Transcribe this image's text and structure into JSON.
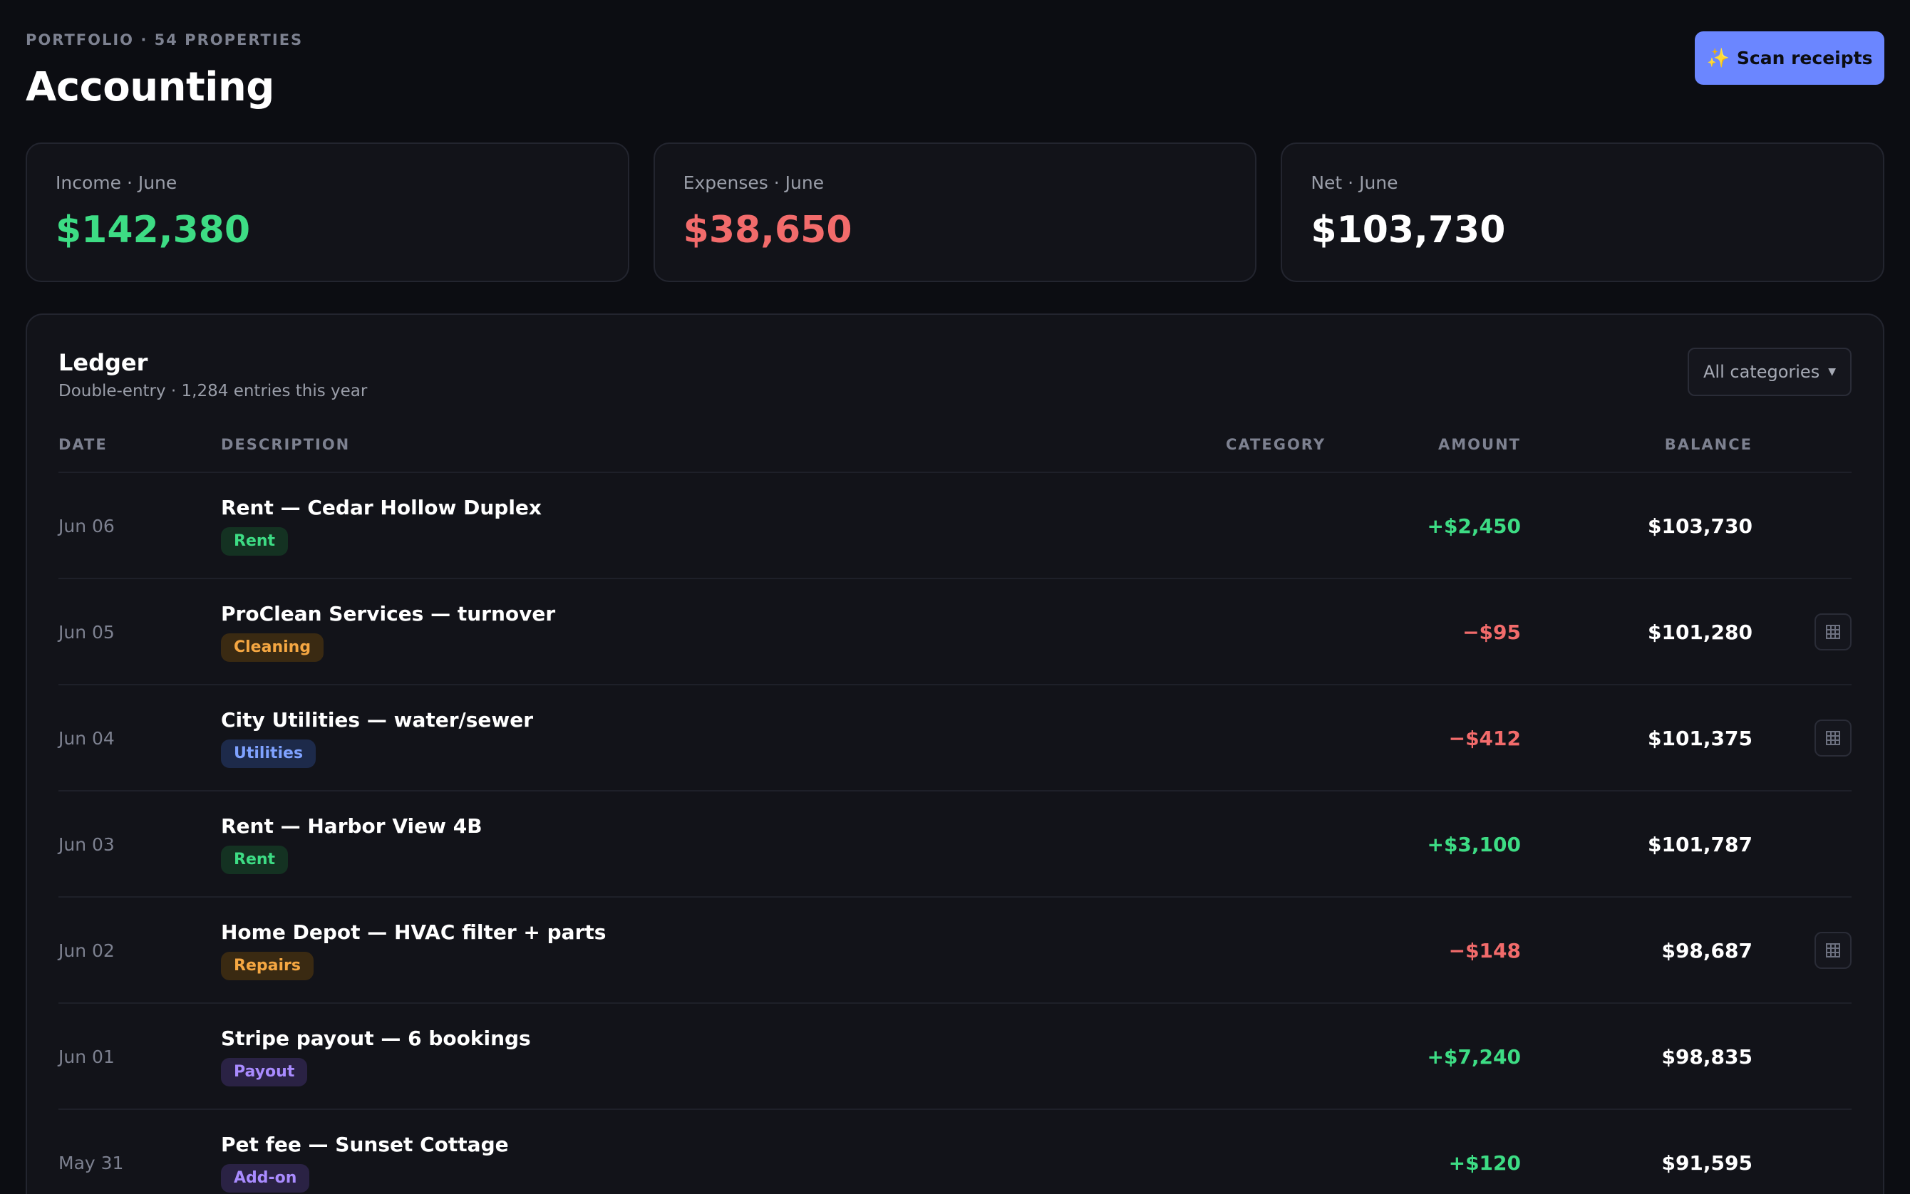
{
  "header": {
    "eyebrow": "PORTFOLIO · 54 PROPERTIES",
    "title": "Accounting",
    "scan_button": "Scan receipts"
  },
  "stats": [
    {
      "label": "Income · June",
      "value": "$142,380",
      "color": "#3ddc84"
    },
    {
      "label": "Expenses · June",
      "value": "$38,650",
      "color": "#f26b6b"
    },
    {
      "label": "Net · June",
      "value": "$103,730",
      "color": "#ffffff"
    }
  ],
  "ledger": {
    "title": "Ledger",
    "subtitle": "Double-entry · 1,284 entries this year",
    "filter": "All categories",
    "columns": {
      "date": "DATE",
      "description": "DESCRIPTION",
      "category": "CATEGORY",
      "amount": "AMOUNT",
      "balance": "BALANCE"
    },
    "rows": [
      {
        "date": "Jun 06",
        "description": "Rent — Cedar Hollow Duplex",
        "tag": "Rent",
        "amount": "+$2,450",
        "balance": "$103,730"
      },
      {
        "date": "Jun 05",
        "description": "ProClean Services — turnover",
        "tag": "Cleaning",
        "amount": "−$95",
        "balance": "$101,280"
      },
      {
        "date": "Jun 04",
        "description": "City Utilities — water/sewer",
        "tag": "Utilities",
        "amount": "−$412",
        "balance": "$101,375"
      },
      {
        "date": "Jun 03",
        "description": "Rent — Harbor View 4B",
        "tag": "Rent",
        "amount": "+$3,100",
        "balance": "$101,787"
      },
      {
        "date": "Jun 02",
        "description": "Home Depot — HVAC filter + parts",
        "tag": "Repairs",
        "amount": "−$148",
        "balance": "$98,687"
      },
      {
        "date": "Jun 01",
        "description": "Stripe payout — 6 bookings",
        "tag": "Payout",
        "amount": "+$7,240",
        "balance": "$98,835"
      },
      {
        "date": "May 31",
        "description": "Pet fee — Sunset Cottage",
        "tag": "Add-on",
        "amount": "+$120",
        "balance": "$91,595"
      }
    ]
  },
  "colors": {
    "background": "#0c0d12",
    "card": "#121319",
    "accent": "#6b86ff",
    "positive": "#3ddc84",
    "negative": "#f26b6b"
  },
  "icons": {
    "scan_button": "sparkles-icon",
    "receipt": "receipt-icon",
    "filter": "caret-down-icon"
  }
}
